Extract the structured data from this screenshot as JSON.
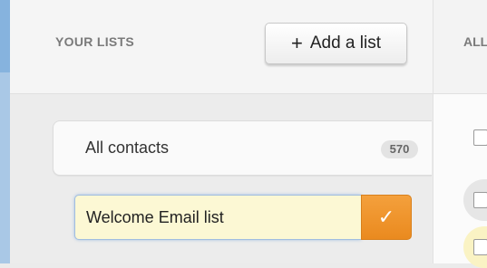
{
  "sidebar": {
    "title": "YOUR LISTS",
    "add_button_label": "Add a list",
    "add_button_icon": "plus-icon",
    "lists": [
      {
        "label": "All contacts",
        "count": "570"
      }
    ],
    "new_list": {
      "value": "Welcome Email list",
      "confirm_icon": "checkmark-icon"
    }
  },
  "main": {
    "header_label": "ALL"
  },
  "colors": {
    "accent": "#ee8f22",
    "input_bg": "#fcf8d4",
    "focus_border": "#a0bde0"
  }
}
